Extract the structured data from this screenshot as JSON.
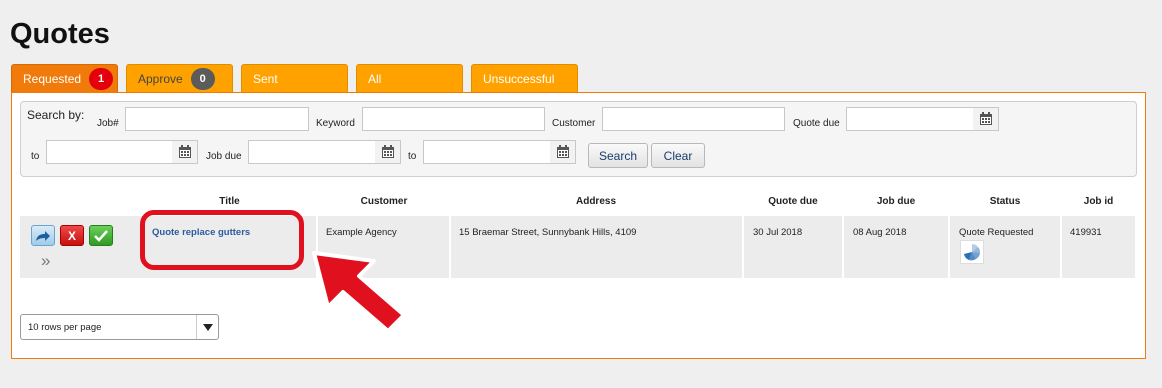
{
  "page_title": "Quotes",
  "tabs": [
    {
      "label": "Requested",
      "count": "1"
    },
    {
      "label": "Approve",
      "count": "0"
    },
    {
      "label": "Sent"
    },
    {
      "label": "All"
    },
    {
      "label": "Unsuccessful"
    }
  ],
  "search": {
    "heading": "Search by:",
    "job_label": "Job#",
    "keyword_label": "Keyword",
    "customer_label": "Customer",
    "quote_due_label": "Quote due",
    "to_label": "to",
    "job_due_label": "Job due",
    "search_button": "Search",
    "clear_button": "Clear",
    "job_value": "",
    "keyword_value": "",
    "customer_value": "",
    "quote_due_from": "",
    "quote_due_to": "",
    "job_due_from": "",
    "job_due_to": ""
  },
  "table": {
    "columns": [
      "Title",
      "Customer",
      "Address",
      "Quote due",
      "Job due",
      "Status",
      "Job id"
    ],
    "rows": [
      {
        "title": "Quote replace gutters",
        "customer": "Example Agency",
        "address": "15 Braemar Street, Sunnybank Hills, 4109",
        "quote_due": "30 Jul 2018",
        "job_due": "08 Aug 2018",
        "status": "Quote Requested",
        "job_id": "419931"
      }
    ]
  },
  "actions": {
    "expand_glyph": "»",
    "reject_glyph": "X"
  },
  "pagination": {
    "rows_per_page": "10 rows per page"
  },
  "colors": {
    "tab_active": "#f07a0a",
    "tab": "#ffa200",
    "badge_red": "#e4000b",
    "link": "#2c5aa0",
    "annotation": "#e0101e"
  },
  "icons": [
    "forward-arrow-icon",
    "reject-x-icon",
    "approve-check-icon",
    "expand-chevrons-icon",
    "calendar-icon",
    "status-spinner-icon",
    "dropdown-arrow-icon",
    "annotation-arrow-icon"
  ]
}
